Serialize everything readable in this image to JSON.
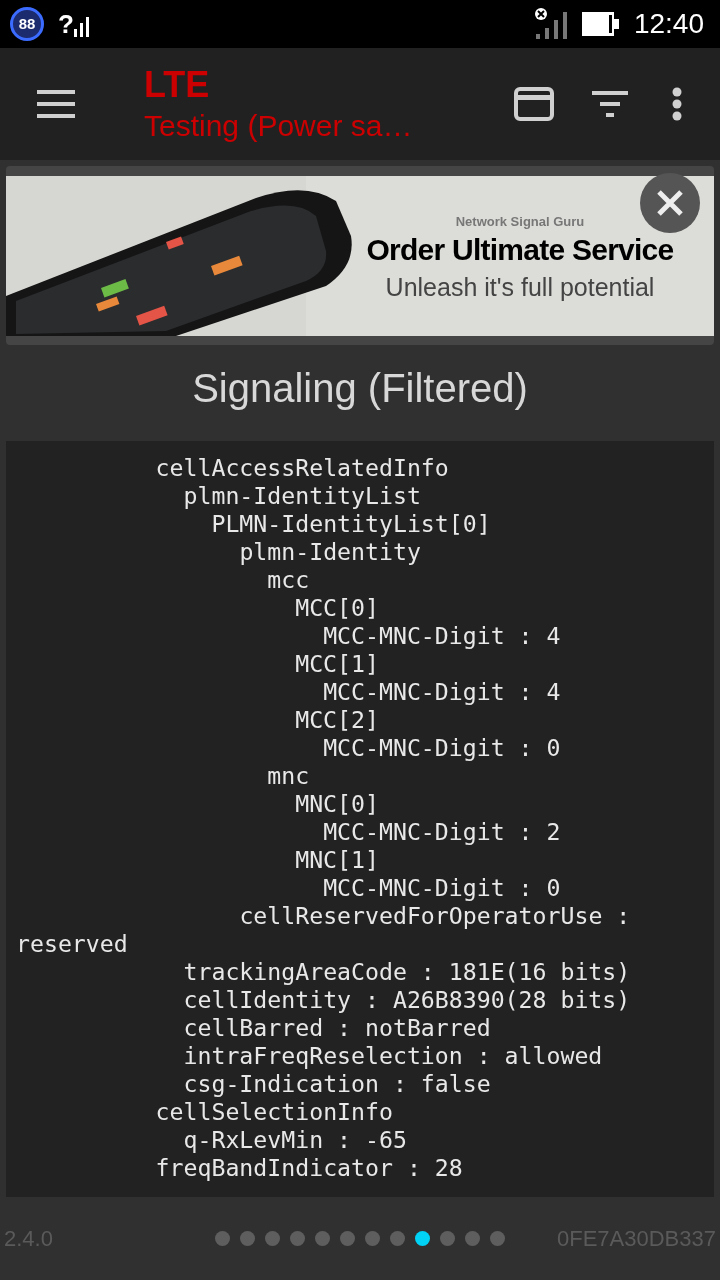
{
  "status_bar": {
    "badge": "88",
    "signal_mark": "?",
    "time": "12:40"
  },
  "toolbar": {
    "title": "LTE",
    "subtitle": "Testing (Power sa…"
  },
  "ad": {
    "brand": "Network Signal Guru",
    "headline": "Order Ultimate Service",
    "tagline": "Unleash it's full potential"
  },
  "section_title": "Signaling (Filtered)",
  "detail": {
    "lines": [
      {
        "text": "cellAccessRelatedInfo",
        "children": [
          {
            "text": "plmn-IdentityList",
            "children": [
              {
                "text": "PLMN-IdentityList[0]",
                "children": [
                  {
                    "text": "plmn-Identity",
                    "children": [
                      {
                        "text": "mcc",
                        "children": [
                          {
                            "text": "MCC[0]",
                            "children": [
                              {
                                "text": "MCC-MNC-Digit : 4"
                              }
                            ]
                          },
                          {
                            "text": "MCC[1]",
                            "children": [
                              {
                                "text": "MCC-MNC-Digit : 4"
                              }
                            ]
                          },
                          {
                            "text": "MCC[2]",
                            "children": [
                              {
                                "text": "MCC-MNC-Digit : 0"
                              }
                            ]
                          }
                        ]
                      },
                      {
                        "text": "mnc",
                        "children": [
                          {
                            "text": "MNC[0]",
                            "children": [
                              {
                                "text": "MCC-MNC-Digit : 2"
                              }
                            ]
                          },
                          {
                            "text": "MNC[1]",
                            "children": [
                              {
                                "text": "MCC-MNC-Digit : 0"
                              }
                            ]
                          }
                        ]
                      }
                    ]
                  },
                  {
                    "text": "cellReservedForOperatorUse : reserved"
                  }
                ]
              }
            ]
          },
          {
            "text": "trackingAreaCode : 181E(16 bits)"
          },
          {
            "text": "cellIdentity : A26B8390(28 bits)"
          },
          {
            "text": "cellBarred : notBarred"
          },
          {
            "text": "intraFreqReselection : allowed"
          },
          {
            "text": "csg-Indication : false"
          }
        ]
      },
      {
        "text": "cellSelectionInfo",
        "children": [
          {
            "text": "q-RxLevMin : -65"
          }
        ]
      },
      {
        "text": "freqBandIndicator : 28"
      }
    ]
  },
  "footer": {
    "version": "2.4.0",
    "device_id": "0FE7A30DB337",
    "pages": [
      {
        "selected": false
      },
      {
        "selected": false
      },
      {
        "selected": false
      },
      {
        "selected": false
      },
      {
        "selected": false
      },
      {
        "selected": false
      },
      {
        "selected": false
      },
      {
        "selected": false
      },
      {
        "selected": true
      },
      {
        "selected": false
      },
      {
        "selected": false
      },
      {
        "selected": false
      }
    ]
  }
}
